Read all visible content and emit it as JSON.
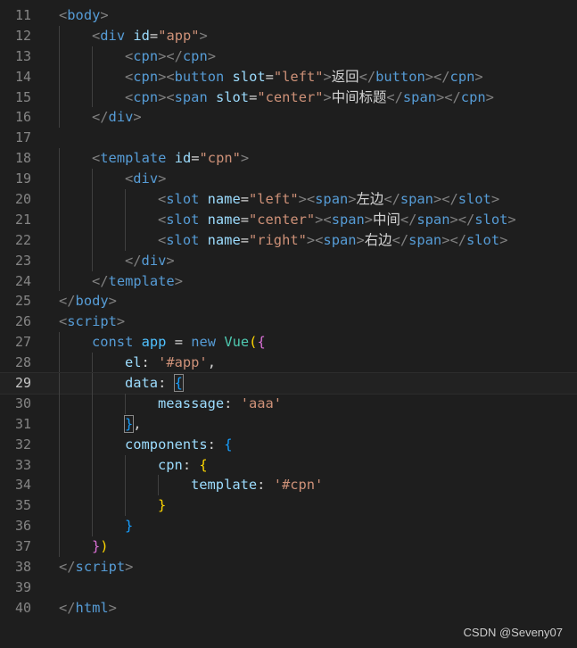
{
  "editor": {
    "current_line": 29,
    "lines": [
      {
        "n": "11",
        "indent": 0,
        "tokens": [
          [
            "<",
            "punct"
          ],
          [
            "body",
            "tag"
          ],
          [
            ">",
            "punct"
          ]
        ]
      },
      {
        "n": "12",
        "indent": 1,
        "tokens": [
          [
            "<",
            "punct"
          ],
          [
            "div",
            "tag"
          ],
          [
            " ",
            "text"
          ],
          [
            "id",
            "attr"
          ],
          [
            "=",
            "text"
          ],
          [
            "\"app\"",
            "str"
          ],
          [
            ">",
            "punct"
          ]
        ]
      },
      {
        "n": "13",
        "indent": 2,
        "tokens": [
          [
            "<",
            "punct"
          ],
          [
            "cpn",
            "tag"
          ],
          [
            "></",
            "punct"
          ],
          [
            "cpn",
            "tag"
          ],
          [
            ">",
            "punct"
          ]
        ]
      },
      {
        "n": "14",
        "indent": 2,
        "tokens": [
          [
            "<",
            "punct"
          ],
          [
            "cpn",
            "tag"
          ],
          [
            "><",
            "punct"
          ],
          [
            "button",
            "tag"
          ],
          [
            " ",
            "text"
          ],
          [
            "slot",
            "attr"
          ],
          [
            "=",
            "text"
          ],
          [
            "\"left\"",
            "str"
          ],
          [
            ">",
            "punct"
          ],
          [
            "返回",
            "text"
          ],
          [
            "</",
            "punct"
          ],
          [
            "button",
            "tag"
          ],
          [
            "></",
            "punct"
          ],
          [
            "cpn",
            "tag"
          ],
          [
            ">",
            "punct"
          ]
        ]
      },
      {
        "n": "15",
        "indent": 2,
        "tokens": [
          [
            "<",
            "punct"
          ],
          [
            "cpn",
            "tag"
          ],
          [
            "><",
            "punct"
          ],
          [
            "span",
            "tag"
          ],
          [
            " ",
            "text"
          ],
          [
            "slot",
            "attr"
          ],
          [
            "=",
            "text"
          ],
          [
            "\"center\"",
            "str"
          ],
          [
            ">",
            "punct"
          ],
          [
            "中间标题",
            "text"
          ],
          [
            "</",
            "punct"
          ],
          [
            "span",
            "tag"
          ],
          [
            "></",
            "punct"
          ],
          [
            "cpn",
            "tag"
          ],
          [
            ">",
            "punct"
          ]
        ]
      },
      {
        "n": "16",
        "indent": 1,
        "tokens": [
          [
            "</",
            "punct"
          ],
          [
            "div",
            "tag"
          ],
          [
            ">",
            "punct"
          ]
        ]
      },
      {
        "n": "17",
        "indent": 0,
        "tokens": []
      },
      {
        "n": "18",
        "indent": 1,
        "tokens": [
          [
            "<",
            "punct"
          ],
          [
            "template",
            "tag"
          ],
          [
            " ",
            "text"
          ],
          [
            "id",
            "attr"
          ],
          [
            "=",
            "text"
          ],
          [
            "\"cpn\"",
            "str"
          ],
          [
            ">",
            "punct"
          ]
        ]
      },
      {
        "n": "19",
        "indent": 2,
        "tokens": [
          [
            "<",
            "punct"
          ],
          [
            "div",
            "tag"
          ],
          [
            ">",
            "punct"
          ]
        ]
      },
      {
        "n": "20",
        "indent": 3,
        "tokens": [
          [
            "<",
            "punct"
          ],
          [
            "slot",
            "tag"
          ],
          [
            " ",
            "text"
          ],
          [
            "name",
            "attr"
          ],
          [
            "=",
            "text"
          ],
          [
            "\"left\"",
            "str"
          ],
          [
            "><",
            "punct"
          ],
          [
            "span",
            "tag"
          ],
          [
            ">",
            "punct"
          ],
          [
            "左边",
            "text"
          ],
          [
            "</",
            "punct"
          ],
          [
            "span",
            "tag"
          ],
          [
            "></",
            "punct"
          ],
          [
            "slot",
            "tag"
          ],
          [
            ">",
            "punct"
          ]
        ]
      },
      {
        "n": "21",
        "indent": 3,
        "tokens": [
          [
            "<",
            "punct"
          ],
          [
            "slot",
            "tag"
          ],
          [
            " ",
            "text"
          ],
          [
            "name",
            "attr"
          ],
          [
            "=",
            "text"
          ],
          [
            "\"center\"",
            "str"
          ],
          [
            "><",
            "punct"
          ],
          [
            "span",
            "tag"
          ],
          [
            ">",
            "punct"
          ],
          [
            "中间",
            "text"
          ],
          [
            "</",
            "punct"
          ],
          [
            "span",
            "tag"
          ],
          [
            "></",
            "punct"
          ],
          [
            "slot",
            "tag"
          ],
          [
            ">",
            "punct"
          ]
        ]
      },
      {
        "n": "22",
        "indent": 3,
        "tokens": [
          [
            "<",
            "punct"
          ],
          [
            "slot",
            "tag"
          ],
          [
            " ",
            "text"
          ],
          [
            "name",
            "attr"
          ],
          [
            "=",
            "text"
          ],
          [
            "\"right\"",
            "str"
          ],
          [
            "><",
            "punct"
          ],
          [
            "span",
            "tag"
          ],
          [
            ">",
            "punct"
          ],
          [
            "右边",
            "text"
          ],
          [
            "</",
            "punct"
          ],
          [
            "span",
            "tag"
          ],
          [
            "></",
            "punct"
          ],
          [
            "slot",
            "tag"
          ],
          [
            ">",
            "punct"
          ]
        ]
      },
      {
        "n": "23",
        "indent": 2,
        "tokens": [
          [
            "</",
            "punct"
          ],
          [
            "div",
            "tag"
          ],
          [
            ">",
            "punct"
          ]
        ]
      },
      {
        "n": "24",
        "indent": 1,
        "tokens": [
          [
            "</",
            "punct"
          ],
          [
            "template",
            "tag"
          ],
          [
            ">",
            "punct"
          ]
        ]
      },
      {
        "n": "25",
        "indent": 0,
        "tokens": [
          [
            "</",
            "punct"
          ],
          [
            "body",
            "tag"
          ],
          [
            ">",
            "punct"
          ]
        ]
      },
      {
        "n": "26",
        "indent": 0,
        "tokens": [
          [
            "<",
            "punct"
          ],
          [
            "script",
            "tag"
          ],
          [
            ">",
            "punct"
          ]
        ]
      },
      {
        "n": "27",
        "indent": 1,
        "tokens": [
          [
            "const",
            "kw"
          ],
          [
            " ",
            "text"
          ],
          [
            "app",
            "var"
          ],
          [
            " = ",
            "text"
          ],
          [
            "new",
            "kw"
          ],
          [
            " ",
            "text"
          ],
          [
            "Vue",
            "cls"
          ],
          [
            "(",
            "b1"
          ],
          [
            "{",
            "b2"
          ]
        ]
      },
      {
        "n": "28",
        "indent": 2,
        "tokens": [
          [
            "el",
            "prop"
          ],
          [
            ": ",
            "text"
          ],
          [
            "'#app'",
            "str"
          ],
          [
            ",",
            "text"
          ]
        ]
      },
      {
        "n": "29",
        "indent": 2,
        "tokens": [
          [
            "data",
            "prop"
          ],
          [
            ": ",
            "text"
          ],
          [
            "{",
            "b3",
            "cursor"
          ]
        ]
      },
      {
        "n": "30",
        "indent": 3,
        "tokens": [
          [
            "meassage",
            "prop"
          ],
          [
            ": ",
            "text"
          ],
          [
            "'aaa'",
            "str"
          ]
        ]
      },
      {
        "n": "31",
        "indent": 2,
        "tokens": [
          [
            "}",
            "b3",
            "cursor"
          ],
          [
            ",",
            "text"
          ]
        ]
      },
      {
        "n": "32",
        "indent": 2,
        "tokens": [
          [
            "components",
            "prop"
          ],
          [
            ": ",
            "text"
          ],
          [
            "{",
            "b3"
          ]
        ]
      },
      {
        "n": "33",
        "indent": 3,
        "tokens": [
          [
            "cpn",
            "prop"
          ],
          [
            ": ",
            "text"
          ],
          [
            "{",
            "b1"
          ]
        ]
      },
      {
        "n": "34",
        "indent": 4,
        "tokens": [
          [
            "template",
            "prop"
          ],
          [
            ": ",
            "text"
          ],
          [
            "'#cpn'",
            "str"
          ]
        ]
      },
      {
        "n": "35",
        "indent": 3,
        "tokens": [
          [
            "}",
            "b1"
          ]
        ]
      },
      {
        "n": "36",
        "indent": 2,
        "tokens": [
          [
            "}",
            "b3"
          ]
        ]
      },
      {
        "n": "37",
        "indent": 1,
        "tokens": [
          [
            "}",
            "b2"
          ],
          [
            ")",
            "b1"
          ]
        ]
      },
      {
        "n": "38",
        "indent": 0,
        "tokens": [
          [
            "</",
            "punct"
          ],
          [
            "script",
            "tag"
          ],
          [
            ">",
            "punct"
          ]
        ]
      },
      {
        "n": "39",
        "indent": 0,
        "tokens": []
      },
      {
        "n": "40",
        "indent": 0,
        "tokens": [
          [
            "</",
            "punct"
          ],
          [
            "html",
            "tag"
          ],
          [
            ">",
            "punct"
          ]
        ]
      }
    ]
  },
  "watermark": "CSDN @Seveny07"
}
